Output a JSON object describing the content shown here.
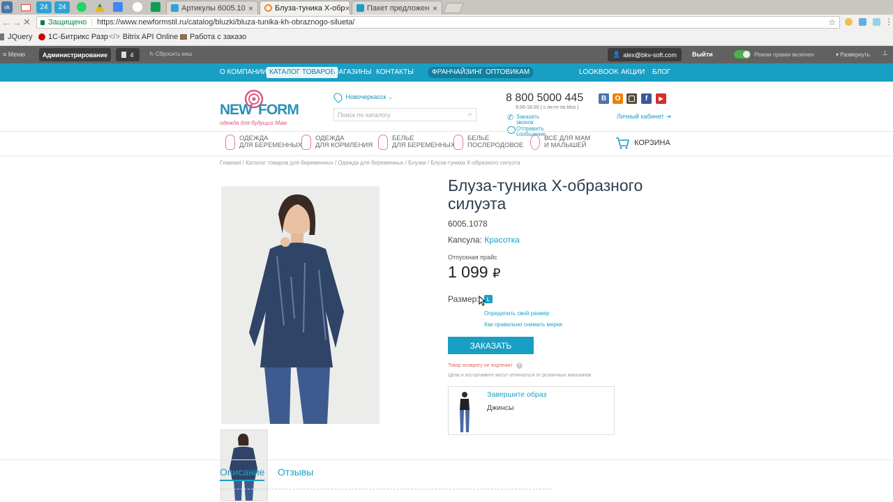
{
  "browser": {
    "mini_tabs": [
      "24",
      "24"
    ],
    "tabs": [
      {
        "label": "Артикулы 6005.10",
        "active": false
      },
      {
        "label": "Блуза-туника Х-обр",
        "active": true
      },
      {
        "label": "Пакет предложен",
        "active": false
      }
    ],
    "secure_label": "Защищено",
    "url": "https://www.newformstil.ru/catalog/bluzki/bluza-tunika-kh-obraznogo-silueta/",
    "bookmarks": [
      "JQuery",
      "1С-Битрикс Разр",
      "Bitrix API Online",
      "Работа с заказо"
    ]
  },
  "admin_bar": {
    "menu": "Меню",
    "admin": "Администрирование",
    "badge_count": "4",
    "clear_cache": "Сбросить кеш",
    "user": "alex@bkv-soft.com",
    "logout": "Выйти",
    "edit_mode": "Режим правки включен",
    "expand": "Развернуть"
  },
  "top_nav": {
    "left": [
      "О КОМПАНИИ",
      "КАТАЛОГ ТОВАРОВ",
      "МАГАЗИНЫ",
      "КОНТАКТЫ"
    ],
    "mid": [
      "ФРАНЧАЙЗИНГ",
      "ОПТОВИКАМ"
    ],
    "right": [
      "LOOKBOOK",
      "АКЦИИ",
      "БЛОГ"
    ]
  },
  "header": {
    "logo_new": "NEW",
    "logo_form": "FORM",
    "logo_tagline": "одежда для будущих Мам",
    "city": "Новочеркасск",
    "search_placeholder": "Поиск по каталогу",
    "phone": "8 800 5000 445",
    "hours": "9.00-18.00 ( с пн-пт по Мск )",
    "callback_1": "Заказать",
    "callback_2": "звонок",
    "message_1": "Отправить",
    "message_2": "сообщение",
    "account": "Личный кабинет",
    "social": [
      "В",
      "О",
      "",
      "f",
      "▶"
    ]
  },
  "cat_nav": [
    {
      "line1": "ОДЕЖДА",
      "line2": "ДЛЯ БЕРЕМЕННЫХ"
    },
    {
      "line1": "ОДЕЖДА",
      "line2": "ДЛЯ КОРМЛЕНИЯ"
    },
    {
      "line1": "БЕЛЬЕ",
      "line2": "ДЛЯ БЕРЕМЕННЫХ"
    },
    {
      "line1": "БЕЛЬЕ",
      "line2": "ПОСЛЕРОДОВОЕ"
    },
    {
      "line1": "ВСЕ ДЛЯ МАМ",
      "line2": "И МАЛЫШЕЙ"
    }
  ],
  "cart": "КОРЗИНА",
  "breadcrumbs": [
    "Главная",
    "Каталог товаров для беременных",
    "Одежда для беременных",
    "Блузки",
    "Блуза-туника Х-образного силуэта"
  ],
  "product": {
    "title_1": "Блуза-туника Х-образного",
    "title_2": "силуэта",
    "article": "6005.1078",
    "capsule_label": "Капсула:",
    "capsule_value": "Красотка",
    "price_label": "Отпускная прайс",
    "price": "1 099",
    "currency": "₽",
    "size_label": "Размер:",
    "size_value": "L",
    "size_find": "Определить свой размер",
    "size_measure": "Как правильно снимать мерки",
    "order_button": "ЗАКАЗАТЬ",
    "no_return": "Товар возврату не подлежит",
    "price_note": "Цена и ассортимент могут отличаться от розничных магазинов",
    "complete_title": "Завершите образ",
    "complete_item": "Джинсы"
  },
  "tabs": [
    "Описание",
    "Отзывы"
  ]
}
